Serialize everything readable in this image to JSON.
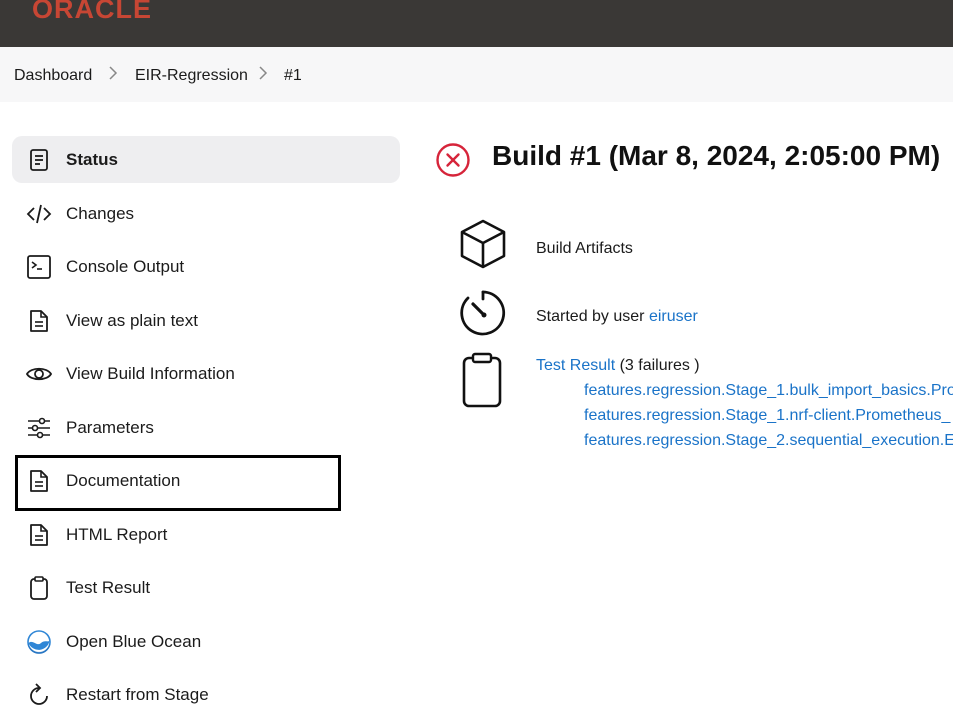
{
  "header": {
    "logo_text": "ORACLE",
    "brand_color": "#c74634",
    "bg_color": "#3a3836"
  },
  "breadcrumb": {
    "items": [
      "Dashboard",
      "EIR-Regression",
      "#1"
    ]
  },
  "sidebar": {
    "items": [
      {
        "label": "Status",
        "icon": "document-icon",
        "active": true
      },
      {
        "label": "Changes",
        "icon": "code-icon",
        "active": false
      },
      {
        "label": "Console Output",
        "icon": "terminal-icon",
        "active": false
      },
      {
        "label": "View as plain text",
        "icon": "file-text-icon",
        "active": false
      },
      {
        "label": "View Build Information",
        "icon": "eye-icon",
        "active": false
      },
      {
        "label": "Parameters",
        "icon": "sliders-icon",
        "active": false
      },
      {
        "label": "Documentation",
        "icon": "file-text-icon",
        "active": false
      },
      {
        "label": "HTML Report",
        "icon": "file-text-icon",
        "active": false
      },
      {
        "label": "Test Result",
        "icon": "clipboard-icon",
        "active": false
      },
      {
        "label": "Open Blue Ocean",
        "icon": "blue-ocean-icon",
        "active": false
      },
      {
        "label": "Restart from Stage",
        "icon": "restart-icon",
        "active": false
      }
    ]
  },
  "main": {
    "title": "Build #1 (Mar 8, 2024, 2:05:00 PM)",
    "status_color": "#d6243a",
    "artifacts_label": "Build Artifacts",
    "started_by_prefix": "Started by user ",
    "started_by_user": "eiruser",
    "test_result_label": "Test Result",
    "test_result_suffix": " (3 failures )",
    "failures": [
      "features.regression.Stage_1.bulk_import_basics.Pro",
      "features.regression.Stage_1.nrf-client.Prometheus_",
      "features.regression.Stage_2.sequential_execution.E"
    ]
  }
}
